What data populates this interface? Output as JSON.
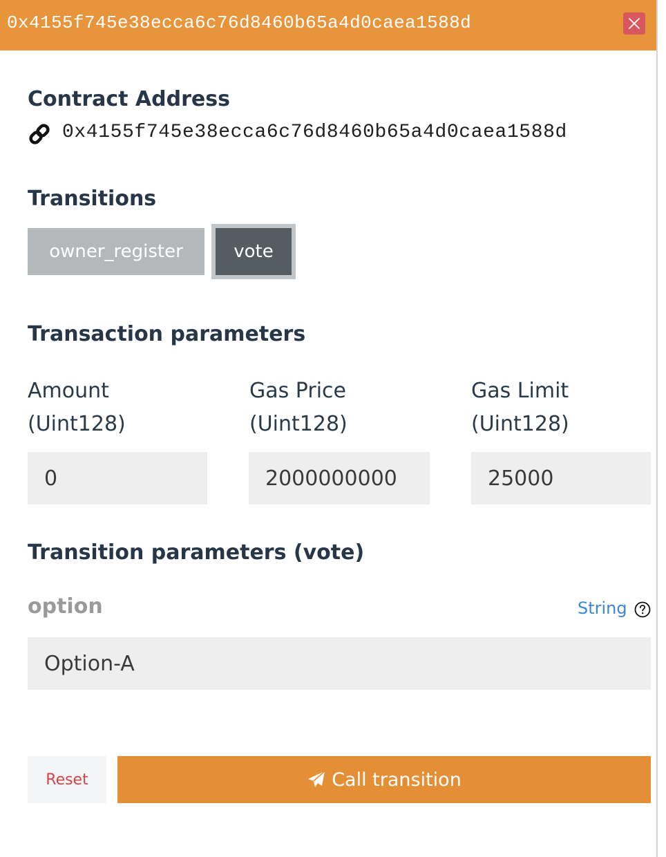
{
  "header": {
    "title": "0x4155f745e38ecca6c76d8460b65a4d0caea1588d",
    "close_icon": "close-icon",
    "color": "#e8943a"
  },
  "contract": {
    "heading": "Contract Address",
    "link_icon": "link-icon",
    "address": "0x4155f745e38ecca6c76d8460b65a4d0caea1588d"
  },
  "transitions": {
    "heading": "Transitions",
    "items": [
      {
        "label": "owner_register",
        "active": false
      },
      {
        "label": "vote",
        "active": true
      }
    ]
  },
  "tx_params": {
    "heading": "Transaction parameters",
    "fields": [
      {
        "label": "Amount",
        "type": "(Uint128)",
        "value": "0"
      },
      {
        "label": "Gas Price",
        "type": "(Uint128)",
        "value": "2000000000"
      },
      {
        "label": "Gas Limit",
        "type": "(Uint128)",
        "value": "25000"
      }
    ]
  },
  "transition_params": {
    "heading": "Transition parameters (vote)",
    "param": {
      "name": "option",
      "type_link": "String",
      "help_icon": "question-circle-icon",
      "value": "Option-A"
    }
  },
  "actions": {
    "reset_label": "Reset",
    "call_label": "Call transition",
    "call_icon": "paper-plane-icon",
    "accent_color": "#e48f36"
  }
}
